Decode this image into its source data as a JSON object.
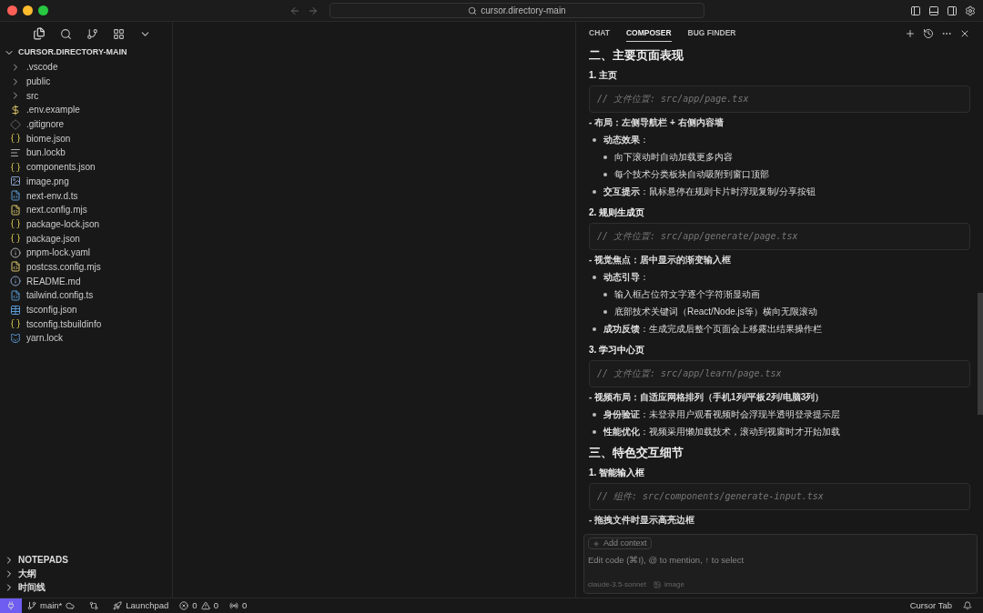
{
  "title_bar": {
    "search": "cursor.directory-main"
  },
  "explorer": {
    "root": {
      "label": "CURSOR.DIRECTORY-MAIN",
      "expanded": true
    },
    "items": [
      {
        "label": ".vscode",
        "kind": "folder"
      },
      {
        "label": "public",
        "kind": "folder"
      },
      {
        "label": "src",
        "kind": "folder"
      },
      {
        "label": ".env.example",
        "kind": "env"
      },
      {
        "label": ".gitignore",
        "kind": "git"
      },
      {
        "label": "biome.json",
        "kind": "json"
      },
      {
        "label": "bun.lockb",
        "kind": "text"
      },
      {
        "label": "components.json",
        "kind": "json"
      },
      {
        "label": "image.png",
        "kind": "image"
      },
      {
        "label": "next-env.d.ts",
        "kind": "ts"
      },
      {
        "label": "next.config.mjs",
        "kind": "js"
      },
      {
        "label": "package-lock.json",
        "kind": "json"
      },
      {
        "label": "package.json",
        "kind": "json"
      },
      {
        "label": "pnpm-lock.yaml",
        "kind": "yaml"
      },
      {
        "label": "postcss.config.mjs",
        "kind": "js"
      },
      {
        "label": "README.md",
        "kind": "info"
      },
      {
        "label": "tailwind.config.ts",
        "kind": "ts"
      },
      {
        "label": "tsconfig.json",
        "kind": "tsconfig"
      },
      {
        "label": "tsconfig.tsbuildinfo",
        "kind": "json"
      },
      {
        "label": "yarn.lock",
        "kind": "yarn"
      }
    ],
    "sections": [
      {
        "label": "NOTEPADS",
        "expanded": false
      },
      {
        "label": "大纲",
        "expanded": false
      },
      {
        "label": "时间线",
        "expanded": false
      }
    ]
  },
  "panel": {
    "tabs": [
      {
        "label": "CHAT",
        "selected": false
      },
      {
        "label": "COMPOSER",
        "selected": true
      },
      {
        "label": "BUG FINDER",
        "selected": false
      }
    ],
    "blocks": [
      {
        "kind": "heading",
        "text": "二、主要页面表现"
      },
      {
        "kind": "subheading",
        "text": "1. 主页"
      },
      {
        "kind": "code",
        "text": "// 文件位置: src/app/page.tsx"
      },
      {
        "kind": "paragraph",
        "text": "- 布局：左侧导航栏 + 右侧内容墙"
      },
      {
        "kind": "list",
        "items": [
          {
            "text": "**动态效果**：",
            "children": [
              {
                "text": "向下滚动时自动加载更多内容"
              },
              {
                "text": "每个技术分类板块自动吸附到窗口顶部"
              }
            ]
          },
          {
            "text": "**交互提示**：鼠标悬停在规则卡片时浮现复制/分享按钮"
          }
        ]
      },
      {
        "kind": "subheading",
        "text": "2. 规则生成页"
      },
      {
        "kind": "code",
        "text": "// 文件位置: src/app/generate/page.tsx"
      },
      {
        "kind": "paragraph",
        "text": "- 视觉焦点：居中显示的渐变输入框"
      },
      {
        "kind": "list",
        "items": [
          {
            "text": "**动态引导**：",
            "children": [
              {
                "text": "输入框占位符文字逐个字符渐显动画"
              },
              {
                "text": "底部技术关键词（React/Node.js等）横向无限滚动"
              }
            ]
          },
          {
            "text": "**成功反馈**：生成完成后整个页面会上移露出结果操作栏"
          }
        ]
      },
      {
        "kind": "subheading",
        "text": "3. 学习中心页"
      },
      {
        "kind": "code",
        "text": "// 文件位置: src/app/learn/page.tsx"
      },
      {
        "kind": "paragraph",
        "text": "- 视频布局：自适应网格排列（手机1列/平板2列/电脑3列）"
      },
      {
        "kind": "list",
        "items": [
          {
            "text": "**身份验证**：未登录用户观看视频时会浮现半透明登录提示层"
          },
          {
            "text": "**性能优化**：视频采用懒加载技术，滚动到视窗时才开始加载"
          }
        ]
      },
      {
        "kind": "heading",
        "text": "三、特色交互细节"
      },
      {
        "kind": "subheading",
        "text": "1. 智能输入框"
      },
      {
        "kind": "code",
        "text": "// 组件: src/components/generate-input.tsx"
      },
      {
        "kind": "paragraph",
        "text": "- 拖拽文件时显示高亮边框"
      }
    ],
    "composer": {
      "add_context": "Add context",
      "placeholder": "Edit code (⌘I), @ to mention, ↑ to select",
      "model": "claude-3.5-sonnet",
      "image": "image"
    }
  },
  "status_bar": {
    "branch": "main*",
    "launchpad": "Launchpad",
    "errors": "0",
    "warnings": "0",
    "ports": "0",
    "cursor_tab": "Cursor Tab"
  }
}
